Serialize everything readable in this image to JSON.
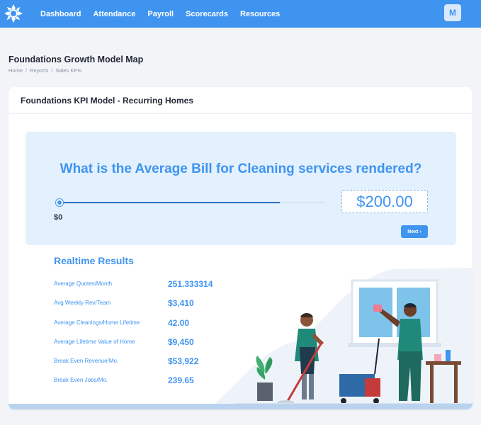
{
  "nav": {
    "items": [
      "Dashboard",
      "Attendance",
      "Payroll",
      "Scorecards",
      "Resources"
    ],
    "avatar_initial": "M"
  },
  "page": {
    "title": "Foundations Growth Model Map",
    "breadcrumb": [
      "Home",
      "Reports",
      "Sales KPIs"
    ]
  },
  "card": {
    "title": "Foundations KPI Model - Recurring Homes"
  },
  "question": {
    "text": "What is the Average Bill for Cleaning services rendered?",
    "slider_min_label": "$0",
    "slider_value_fraction": 0.83,
    "amount_value": "$200.00",
    "next_label": "Next ›"
  },
  "results": {
    "title": "Realtime Results",
    "rows": [
      {
        "label": "Average Quotes/Month",
        "value": "251.333314"
      },
      {
        "label": "Avg Weekly Rev/Team",
        "value": "$3,410"
      },
      {
        "label": "Average Cleanings/Home Lifetime",
        "value": "42.00"
      },
      {
        "label": "Average Lifetime Value of Home",
        "value": "$9,450"
      },
      {
        "label": "Break Even Revenue/Mo.",
        "value": "$53,922"
      },
      {
        "label": "Break Even Jobs/Mo.",
        "value": "239.65"
      }
    ]
  },
  "colors": {
    "brand": "#3f94f0",
    "panel": "#e3f0fd",
    "uniform": "#1f8a7a"
  },
  "icons": {
    "logo": "brand-logo-icon",
    "next": "chevron-right-icon"
  }
}
